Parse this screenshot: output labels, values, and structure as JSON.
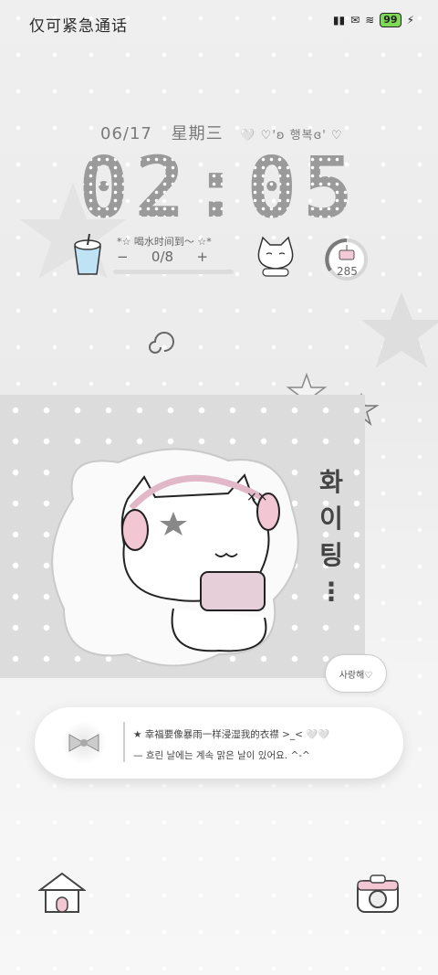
{
  "status": {
    "carrier_text": "仅可紧急通话",
    "battery": "99"
  },
  "lock": {
    "date": "06/17",
    "weekday": "星期三",
    "decor": "🤍 ♡'ʚ 행복ɞ' ♡",
    "time": "02:05"
  },
  "water": {
    "title": "*☆ 喝水时间到～ ☆*",
    "minus": "−",
    "count": "0/8",
    "plus": "+",
    "progress": 0
  },
  "steps": {
    "count": "285"
  },
  "widget": {
    "fighting": "화\n이\n팅\n⋮",
    "bubble": "사랑해♡"
  },
  "card": {
    "line1": "★ 幸福要像暴雨一样浸湿我的衣襟 >_< 🤍🤍",
    "line2": "— 흐린 날에는 계속 맑은 날이 있어요. ^-^"
  },
  "colors": {
    "clock": "#9a9a9a",
    "panel": "#dcdcdc",
    "battery": "#7ed957"
  },
  "icons": [
    "signal-icon",
    "message-icon",
    "wifi-icon",
    "battery-icon",
    "charging-icon",
    "cup-icon",
    "cat-icon",
    "cake-icon",
    "spiral-icon",
    "star-icon",
    "bow-icon",
    "home-icon",
    "camera-icon"
  ]
}
